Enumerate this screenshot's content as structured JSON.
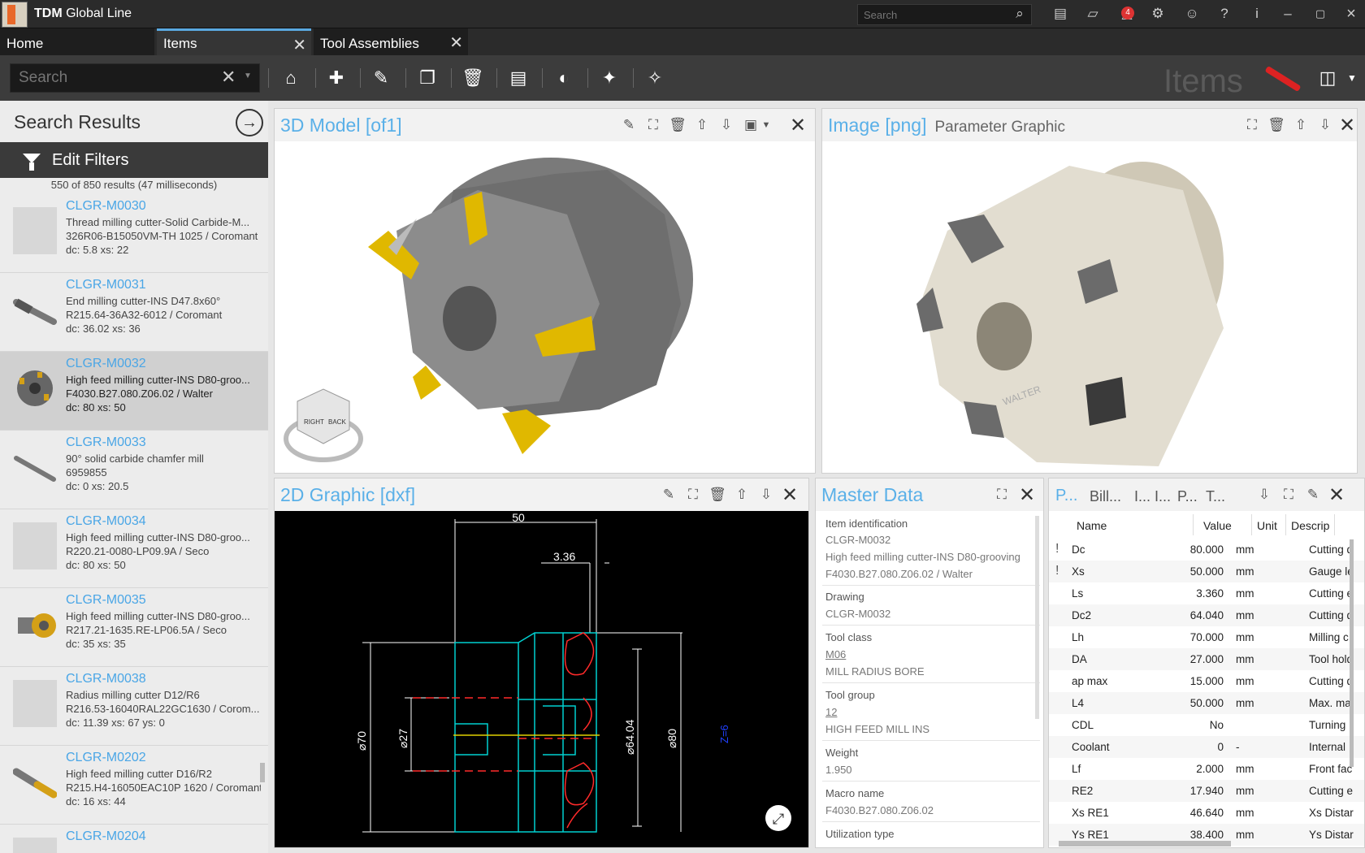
{
  "app": {
    "title_bold": "TDM",
    "title_rest": " Global Line"
  },
  "topbar": {
    "search_placeholder": "Search",
    "notification_count": "4"
  },
  "tabs": [
    {
      "label": "Home"
    },
    {
      "label": "Items"
    },
    {
      "label": "Tool Assemblies"
    }
  ],
  "toolbar": {
    "search_placeholder": "Search",
    "module_label": "Items"
  },
  "search_results": {
    "title": "Search Results",
    "edit_filters": "Edit Filters",
    "count": "550 of 850 results (47 milliseconds)",
    "items": [
      {
        "id": "CLGR-M0030",
        "desc": "Thread milling cutter-Solid Carbide-M...",
        "code": "326R06-B15050VM-TH 1025 / Coromant",
        "params": "dc: 5.8 xs: 22"
      },
      {
        "id": "CLGR-M0031",
        "desc": "End milling cutter-INS D47.8x60°",
        "code": "R215.64-36A32-6012 / Coromant",
        "params": "dc: 36.02 xs: 36"
      },
      {
        "id": "CLGR-M0032",
        "desc": "High feed milling cutter-INS D80-groo...",
        "code": "F4030.B27.080.Z06.02 / Walter",
        "params": "dc: 80 xs: 50"
      },
      {
        "id": "CLGR-M0033",
        "desc": "90° solid carbide chamfer mill",
        "code": "6959855",
        "params": "dc: 0 xs: 20.5"
      },
      {
        "id": "CLGR-M0034",
        "desc": "High feed milling cutter-INS D80-groo...",
        "code": "R220.21-0080-LP09.9A / Seco",
        "params": "dc: 80 xs: 50"
      },
      {
        "id": "CLGR-M0035",
        "desc": "High feed milling cutter-INS D80-groo...",
        "code": "R217.21-1635.RE-LP06.5A / Seco",
        "params": "dc: 35 xs: 35"
      },
      {
        "id": "CLGR-M0038",
        "desc": "Radius milling cutter D12/R6",
        "code": "R216.53-16040RAL22GC1630 / Corom...",
        "params": "dc: 11.39 xs: 67 ys: 0"
      },
      {
        "id": "CLGR-M0202",
        "desc": "High feed milling cutter D16/R2",
        "code": "R215.H4-16050EAC10P 1620 / Coromant",
        "params": "dc: 16 xs: 44"
      },
      {
        "id": "CLGR-M0204",
        "desc": "",
        "code": "",
        "params": ""
      }
    ]
  },
  "panels": {
    "model3d": {
      "title": "3D Model [of1]",
      "cube_right": "RIGHT",
      "cube_back": "BACK"
    },
    "image": {
      "title": "Image [png]",
      "subtitle": "Parameter Graphic",
      "brand": "WALTER"
    },
    "graphic2d": {
      "title": "2D Graphic [dxf]",
      "dims": {
        "d50": "50",
        "d336": "3.36",
        "d70": "⌀70",
        "d27": "⌀27",
        "d6404": "⌀64.04",
        "d80": "⌀80",
        "z6": "Z=6"
      }
    },
    "master": {
      "title": "Master Data",
      "fields": [
        {
          "label": "Item identification",
          "values": [
            "CLGR-M0032",
            "High feed milling cutter-INS D80-grooving",
            "F4030.B27.080.Z06.02 / Walter"
          ]
        },
        {
          "label": "Drawing",
          "values": [
            "CLGR-M0032"
          ]
        },
        {
          "label": "Tool class",
          "values": [
            "M06",
            "MILL RADIUS BORE"
          ]
        },
        {
          "label": "Tool group",
          "values": [
            "12",
            "HIGH FEED MILL INS"
          ]
        },
        {
          "label": "Weight",
          "values": [
            "1.950"
          ]
        },
        {
          "label": "Macro name",
          "values": [
            "F4030.B27.080.Z06.02"
          ]
        },
        {
          "label": "Utilization type",
          "values": []
        }
      ]
    },
    "params": {
      "tabs": [
        "P...",
        "Bill...",
        "I...",
        "I...",
        "P...",
        "T..."
      ],
      "columns": [
        "Name",
        "Value",
        "Unit",
        "Descrip"
      ],
      "rows": [
        {
          "warn": "!",
          "name": "Dc",
          "value": "80.000",
          "unit": "mm",
          "desc": "Cutting d"
        },
        {
          "warn": "!",
          "name": "Xs",
          "value": "50.000",
          "unit": "mm",
          "desc": "Gauge le"
        },
        {
          "warn": "",
          "name": "Ls",
          "value": "3.360",
          "unit": "mm",
          "desc": "Cutting e"
        },
        {
          "warn": "",
          "name": "Dc2",
          "value": "64.040",
          "unit": "mm",
          "desc": "Cutting d"
        },
        {
          "warn": "",
          "name": "Lh",
          "value": "70.000",
          "unit": "mm",
          "desc": "Milling c"
        },
        {
          "warn": "",
          "name": "DA",
          "value": "27.000",
          "unit": "mm",
          "desc": "Tool hold"
        },
        {
          "warn": "",
          "name": "ap max",
          "value": "15.000",
          "unit": "mm",
          "desc": "Cutting d"
        },
        {
          "warn": "",
          "name": "L4",
          "value": "50.000",
          "unit": "mm",
          "desc": "Max. ma"
        },
        {
          "warn": "",
          "name": "CDL",
          "value": "No",
          "unit": "",
          "desc": "Turning"
        },
        {
          "warn": "",
          "name": "Coolant",
          "value": "0",
          "unit": "-",
          "desc": "Internal"
        },
        {
          "warn": "",
          "name": "Lf",
          "value": "2.000",
          "unit": "mm",
          "desc": "Front fac"
        },
        {
          "warn": "",
          "name": "RE2",
          "value": "17.940",
          "unit": "mm",
          "desc": "Cutting e"
        },
        {
          "warn": "",
          "name": "Xs RE1",
          "value": "46.640",
          "unit": "mm",
          "desc": "Xs Distar"
        },
        {
          "warn": "",
          "name": "Ys RE1",
          "value": "38.400",
          "unit": "mm",
          "desc": "Ys Distar"
        }
      ]
    }
  }
}
